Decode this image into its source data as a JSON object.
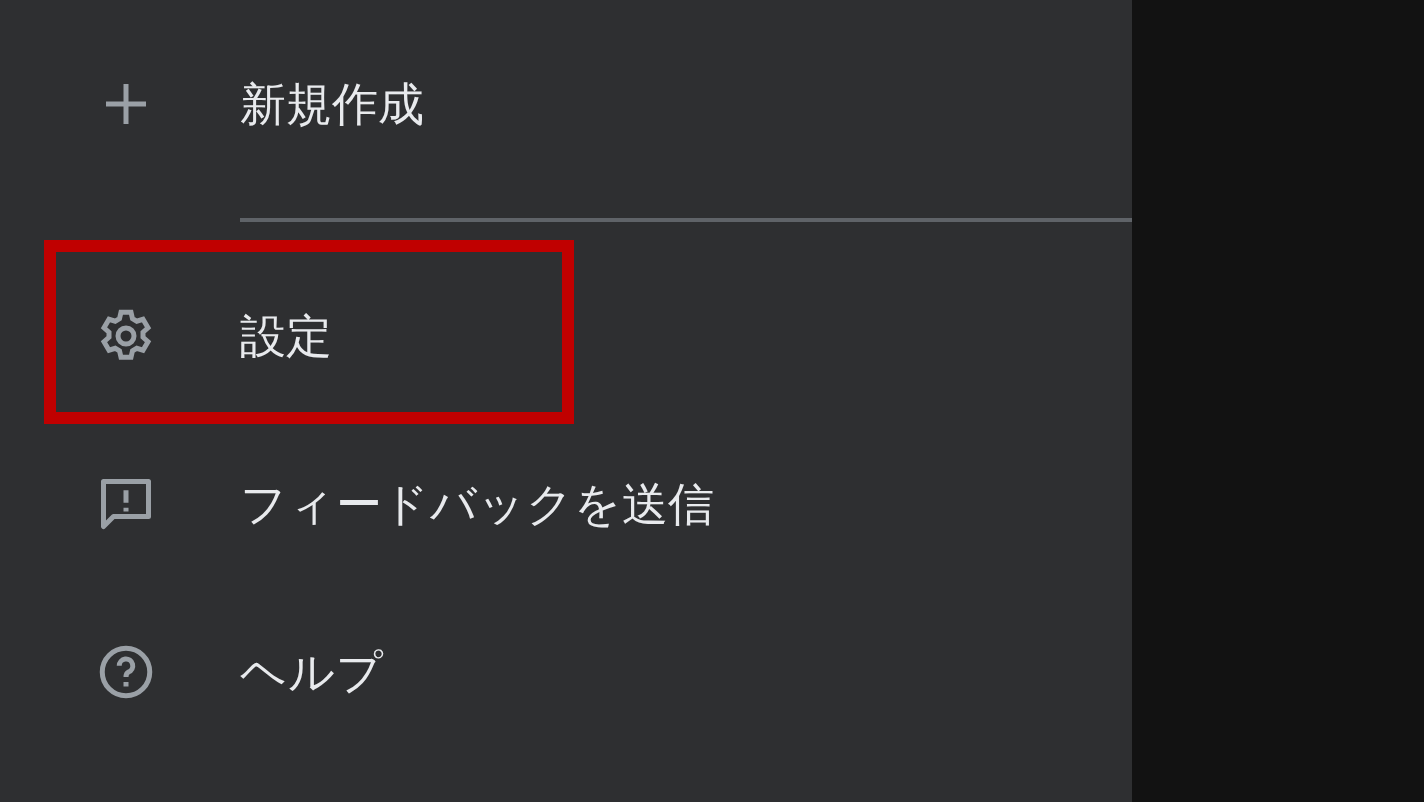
{
  "menu": {
    "items": [
      {
        "kind": "plus",
        "label": "新規作成",
        "highlighted": false,
        "divider_after": true
      },
      {
        "kind": "gear",
        "label": "設定",
        "highlighted": true,
        "divider_after": false
      },
      {
        "kind": "feedback",
        "label": "フィードバックを送信",
        "highlighted": false,
        "divider_after": false
      },
      {
        "kind": "help",
        "label": "ヘルプ",
        "highlighted": false,
        "divider_after": false
      }
    ]
  }
}
